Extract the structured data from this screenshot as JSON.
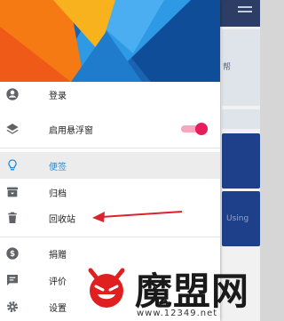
{
  "background": {
    "fragment_top": "帮",
    "fragment_mid": "Using"
  },
  "drawer": {
    "items": [
      {
        "label": "登录",
        "icon": "account-circle-icon"
      },
      {
        "label": "启用悬浮窗",
        "icon": "layers-icon",
        "toggle_on": true
      },
      {
        "label": "便签",
        "icon": "lightbulb-icon",
        "selected": true
      },
      {
        "label": "归档",
        "icon": "archive-icon"
      },
      {
        "label": "回收站",
        "icon": "trash-icon"
      },
      {
        "label": "捐赠",
        "icon": "dollar-icon"
      },
      {
        "label": "评价",
        "icon": "feedback-icon"
      },
      {
        "label": "设置",
        "icon": "gear-icon"
      }
    ]
  },
  "colors": {
    "accent": "#e61e5c",
    "selected_text": "#2e8ed6",
    "annotation_arrow": "#d9232e"
  },
  "watermark": {
    "title": "魔盟网",
    "url": "www.12349.net"
  }
}
